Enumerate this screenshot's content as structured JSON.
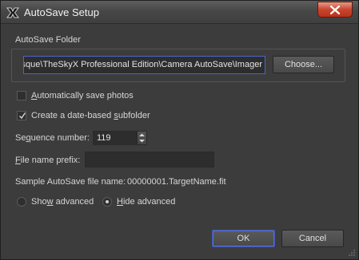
{
  "window": {
    "title": "AutoSave Setup"
  },
  "folder": {
    "group_label": "AutoSave Folder",
    "path": "isque\\TheSkyX Professional Edition\\Camera AutoSave\\Imager",
    "choose_label": "Choose..."
  },
  "options": {
    "auto_save_pre": "A",
    "auto_save_rest": "utomatically save photos",
    "auto_save_checked": false,
    "date_subfolder_pre": "Create a date-based ",
    "date_subfolder_u": "s",
    "date_subfolder_rest": "ubfolder",
    "date_subfolder_checked": true
  },
  "sequence": {
    "label_pre": "Se",
    "label_u": "q",
    "label_rest": "uence number:",
    "value": "119"
  },
  "prefix": {
    "label_u": "F",
    "label_rest": "ile name prefix:",
    "value": ""
  },
  "sample": {
    "label": "Sample AutoSave file name:",
    "value": "00000001.TargetName.fit"
  },
  "advanced": {
    "show_pre": "Sho",
    "show_u": "w",
    "show_rest": " advanced",
    "hide_u": "H",
    "hide_rest": "ide advanced",
    "selected": "hide"
  },
  "buttons": {
    "ok": "OK",
    "cancel": "Cancel"
  }
}
